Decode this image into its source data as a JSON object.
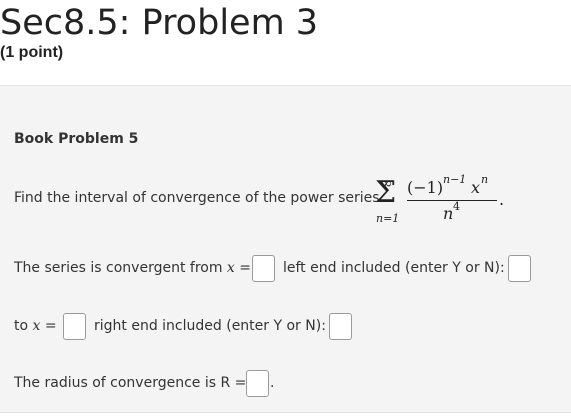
{
  "page": {
    "title": "Sec8.5: Problem 3",
    "points": "(1 point)"
  },
  "problem": {
    "heading": "Book Problem 5",
    "prompt": "Find the interval of convergence of the power series",
    "formula": {
      "sum_upper": "∞",
      "sum_lower": "n=1",
      "numerator": "(−1)",
      "numerator_exp": "n−1",
      "numerator_var": "x",
      "numerator_var_exp": "n",
      "denominator": "n",
      "denominator_exp": "4",
      "end_punct": "."
    },
    "line1_prefix": "The series is convergent from ",
    "line1_var": "x",
    "equals": "=",
    "left_end_label": "left end included (enter Y or N):",
    "line2_prefix": "to ",
    "line2_var": "x",
    "right_end_label": "right end included (enter Y or N):",
    "radius_label": "The radius of convergence is R  ="
  },
  "answers": {
    "from_x": "",
    "left_included": "",
    "to_x": "",
    "right_included": "",
    "radius": ""
  }
}
